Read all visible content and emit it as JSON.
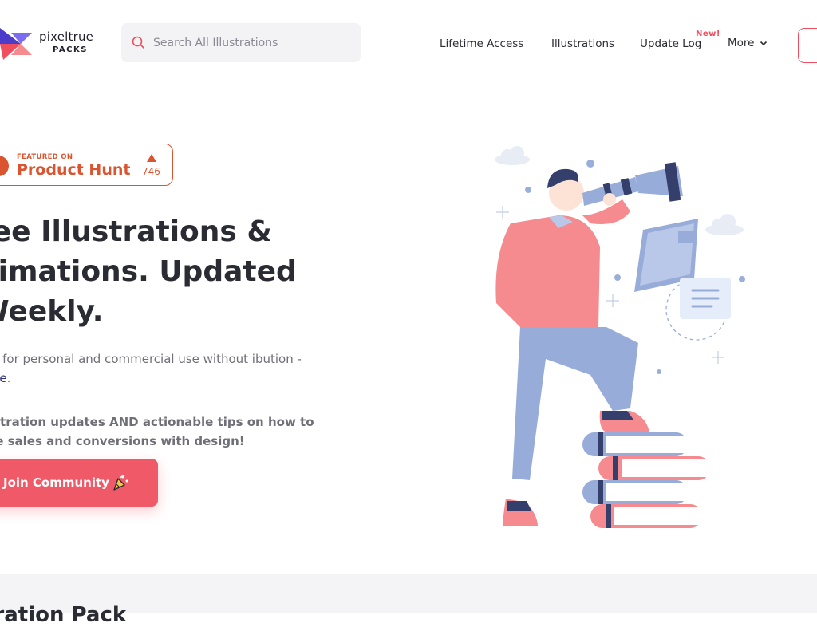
{
  "brand": {
    "name": "pixeltrue",
    "sub": "PACKS"
  },
  "search": {
    "placeholder": "Search All Illustrations"
  },
  "nav": {
    "items": [
      {
        "label": "Lifetime Access"
      },
      {
        "label": "Illustrations"
      },
      {
        "label": "Update Log",
        "badge": "New!"
      },
      {
        "label": "More"
      }
    ]
  },
  "product_hunt": {
    "featured": "FEATURED ON",
    "name": "Product Hunt",
    "count": "746"
  },
  "hero": {
    "headline": "ree Illustrations & nimations. Updated Weekly.",
    "desc_text": " to use for personal and commercial use without ibution - ",
    "license_link": "License",
    "desc_end": ".",
    "bold_text": "illustration updates AND actionable tips on how to ease sales and conversions with design!",
    "join_label": "Join Community"
  },
  "section2": {
    "heading": "tration Pack"
  },
  "colors": {
    "accent": "#f05a68",
    "product_hunt": "#da552f",
    "primary_text": "#2b2b33",
    "link": "#2f2f86"
  },
  "icons": {
    "search": "search-icon",
    "chevron": "chevron-down-icon",
    "party": "party-popper-icon"
  }
}
